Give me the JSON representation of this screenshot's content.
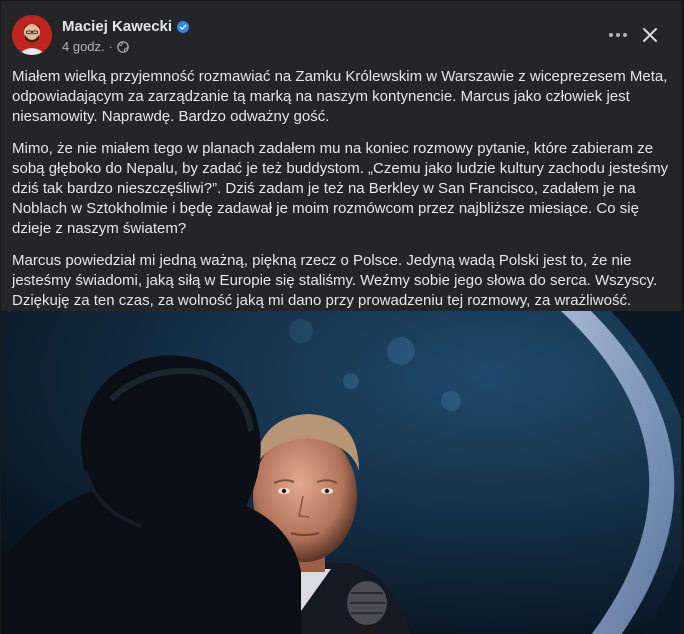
{
  "post": {
    "author": "Maciej Kawecki",
    "time": "4 godz.",
    "separator": "·",
    "audience_icon": "globe-icon",
    "paragraphs": [
      "Miałem wielką przyjemność rozmawiać na Zamku Królewskim w Warszawie z wiceprezesem Meta, odpowiadającym za zarządzanie tą marką na naszym kontynencie. Marcus jako człowiek jest niesamowity. Naprawdę. Bardzo odważny gość.",
      "Mimo, że nie miałem tego w planach zadałem mu na koniec rozmowy pytanie, które zabieram ze sobą głęboko do Nepalu, by zadać je też buddystom. „Czemu jako ludzie kultury zachodu jesteśmy dziś tak bardzo nieszczęśliwi?”. Dziś zadam je też na Berkley w San Francisco, zadałem je na Noblach w Sztokholmie i będę zadawał je moim rozmówcom przez najbliższe miesiące. Co się dzieje z naszym światem?",
      "Marcus powiedział mi jedną ważną, piękną rzecz o Polsce. Jedyną wadą Polski jest to, że nie jesteśmy świadomi, jaką siłą w Europie się staliśmy. Weźmy sobie jego słowa do serca. Wszyscy. Dziękuję za ten czas, za wolność jaką mi dano przy prowadzeniu tej rozmowy, za wrażliwość."
    ]
  },
  "colors": {
    "background": "#242526",
    "text": "#e4e6eb",
    "secondary_text": "#b0b3b8",
    "verified_badge": "#2d88ff"
  },
  "icons": {
    "more": "more-horizontal-icon",
    "close": "close-icon",
    "verified": "verified-badge-icon"
  }
}
